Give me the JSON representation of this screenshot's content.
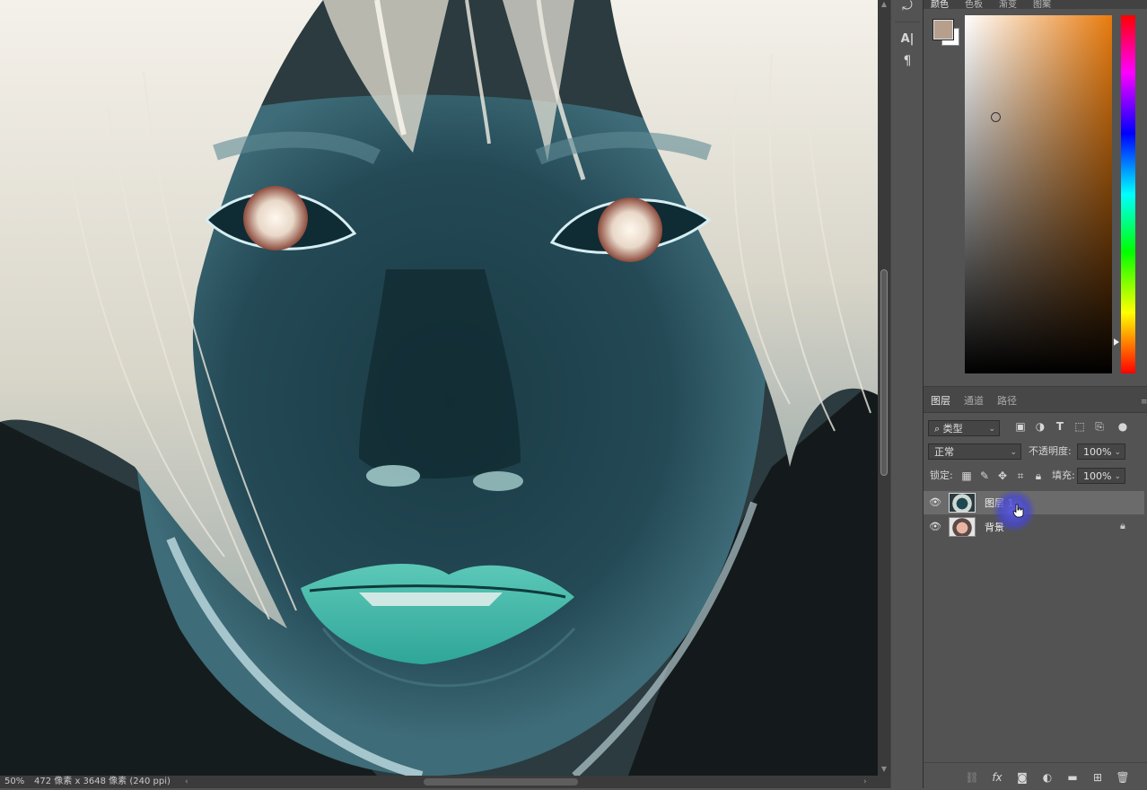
{
  "status_bar": {
    "zoom": "50%",
    "doc_info": "472 像素 x 3648 像素 (240 ppi)"
  },
  "tools": [
    "history-brush-icon",
    "character-icon",
    "paragraph-icon"
  ],
  "color_panel": {
    "tabs": [
      "颜色",
      "色板",
      "渐变",
      "图案"
    ],
    "foreground_color": "#b79f8e",
    "background_color": "#ffffff"
  },
  "layers_panel": {
    "tabs": [
      "图层",
      "通道",
      "路径"
    ],
    "filter_type": "类型",
    "blend_mode": "正常",
    "opacity_label": "不透明度:",
    "opacity_value": "100%",
    "lock_label": "锁定:",
    "fill_label": "填充:",
    "fill_value": "100%",
    "layers": [
      {
        "name": "图层 1",
        "selected": true,
        "locked": false
      },
      {
        "name": "背景",
        "selected": false,
        "locked": true
      }
    ]
  },
  "colors": {
    "ui_bg": "#535353",
    "selected_row": "#6b6b6b",
    "cursor_highlight": "#5a5ae6"
  }
}
